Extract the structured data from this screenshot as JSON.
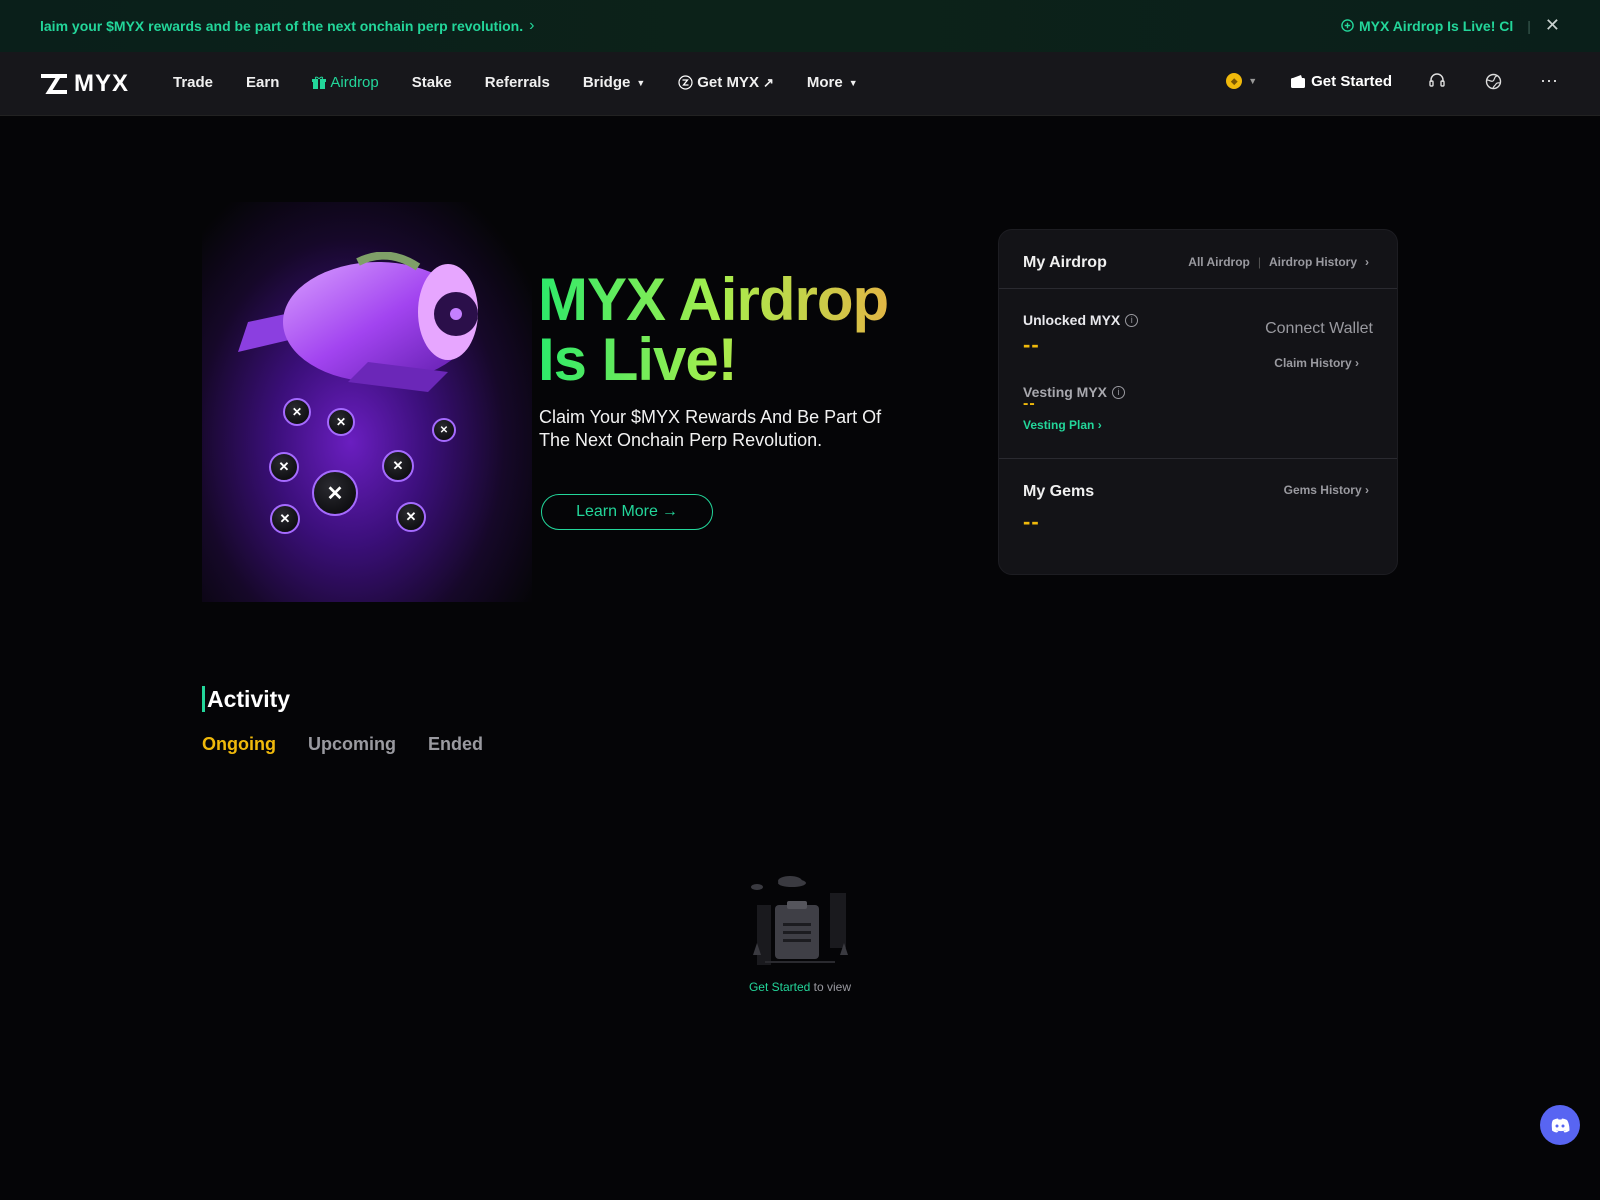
{
  "banner": {
    "message": "laim your $MYX rewards and be part of the next onchain perp revolution.",
    "chevron": "›",
    "right_message": "MYX Airdrop Is Live! Cl",
    "separator": "|",
    "close": "✕",
    "icon": "gift-icon"
  },
  "nav": {
    "logo_text": "MYX",
    "links": {
      "trade": "Trade",
      "earn": "Earn",
      "airdrop": "Airdrop",
      "stake": "Stake",
      "referrals": "Referrals",
      "bridge": "Bridge",
      "get_myx": "Get MYX",
      "more": "More"
    },
    "get_started": "Get Started",
    "chain_icon": "bnb-chain-icon",
    "accent_color": "#23d69a"
  },
  "hero": {
    "title_line1": "MYX Airdrop",
    "title_line2": "Is Live!",
    "subtitle": "Claim Your $MYX Rewards And Be Part Of The Next Onchain Perp Revolution.",
    "learn_more": "Learn More",
    "arrow": "→"
  },
  "panel": {
    "title": "My Airdrop",
    "all_airdrop": "All Airdrop",
    "airdrop_history": "Airdrop History",
    "unlocked_label": "Unlocked MYX",
    "unlocked_value": "--",
    "connect_wallet": "Connect Wallet",
    "claim_history": "Claim History",
    "vesting_label": "Vesting MYX",
    "vesting_value": "--",
    "vesting_plan": "Vesting Plan",
    "gems_title": "My Gems",
    "gems_history": "Gems History",
    "gems_value": "--",
    "chevron": "›"
  },
  "activity": {
    "title": "Activity",
    "tabs": {
      "ongoing": "Ongoing",
      "upcoming": "Upcoming",
      "ended": "Ended"
    },
    "empty_link": "Get Started",
    "empty_text": " to view"
  },
  "colors": {
    "accent_green": "#23d69a",
    "accent_yellow": "#f0b90b",
    "background": "#050507",
    "discord": "#5865f2"
  }
}
